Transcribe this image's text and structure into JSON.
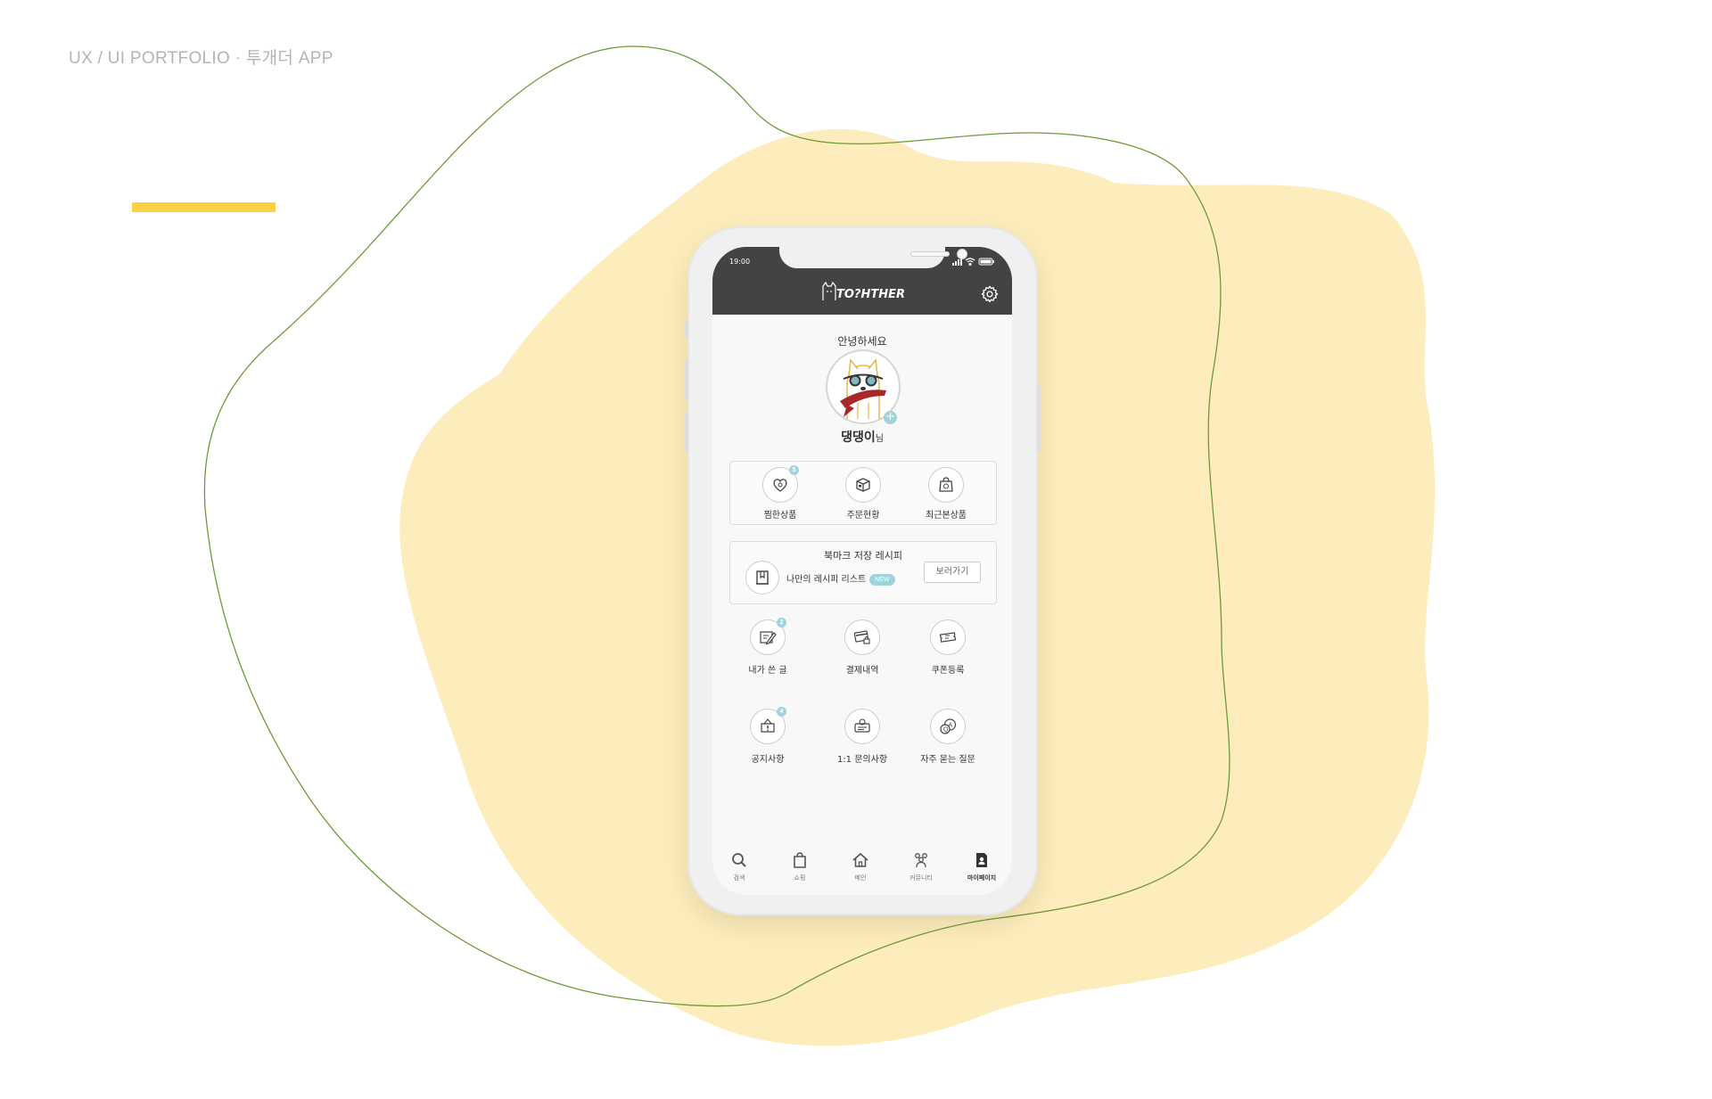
{
  "caption": "UX / UI PORTFOLIO · 투개더 APP",
  "colors": {
    "accent_yellow": "#fed145",
    "blob_yellow": "#fdedbc",
    "outline_green": "#6e9a3a",
    "app_dark": "#434343",
    "badge_teal": "#9fd3de"
  },
  "status_bar": {
    "time": "19:00",
    "icons": [
      "signal-icon",
      "wifi-icon",
      "battery-icon"
    ]
  },
  "header": {
    "logo_text": "TO?HTHER",
    "settings_icon": "gear-icon"
  },
  "profile": {
    "greeting": "안녕하세요",
    "name": "댕댕이",
    "suffix": "님",
    "add_symbol": "+"
  },
  "quick_menu": [
    {
      "label": "찜한상품",
      "icon": "heart-bag-icon",
      "badge": "5"
    },
    {
      "label": "주문현황",
      "icon": "box-icon",
      "badge": ""
    },
    {
      "label": "최근본상품",
      "icon": "shopping-bag-icon",
      "badge": ""
    }
  ],
  "bookmark": {
    "title": "북마크 저장 레시피",
    "text": "나만의 레시피 리스트",
    "badge": "NEW",
    "button": "보러가기",
    "icon": "bookmark-book-icon"
  },
  "menu_grid": [
    {
      "label": "내가 쓴 글",
      "icon": "pencil-note-icon",
      "badge": "2"
    },
    {
      "label": "결제내역",
      "icon": "card-lock-icon",
      "badge": ""
    },
    {
      "label": "쿠폰등록",
      "icon": "coupon-icon",
      "badge": ""
    },
    {
      "label": "공지사항",
      "icon": "notice-icon",
      "badge": "4"
    },
    {
      "label": "1:1 문의사항",
      "icon": "inquiry-icon",
      "badge": ""
    },
    {
      "label": "자주 묻는 질문",
      "icon": "faq-icon",
      "badge": ""
    }
  ],
  "tabs": [
    {
      "label": "검색",
      "icon": "search-icon",
      "active": false
    },
    {
      "label": "쇼핑",
      "icon": "shopping-bag-icon",
      "active": false
    },
    {
      "label": "메인",
      "icon": "home-icon",
      "active": false
    },
    {
      "label": "커뮤니티",
      "icon": "community-icon",
      "active": false
    },
    {
      "label": "마이페이지",
      "icon": "mypage-icon",
      "active": true
    }
  ]
}
